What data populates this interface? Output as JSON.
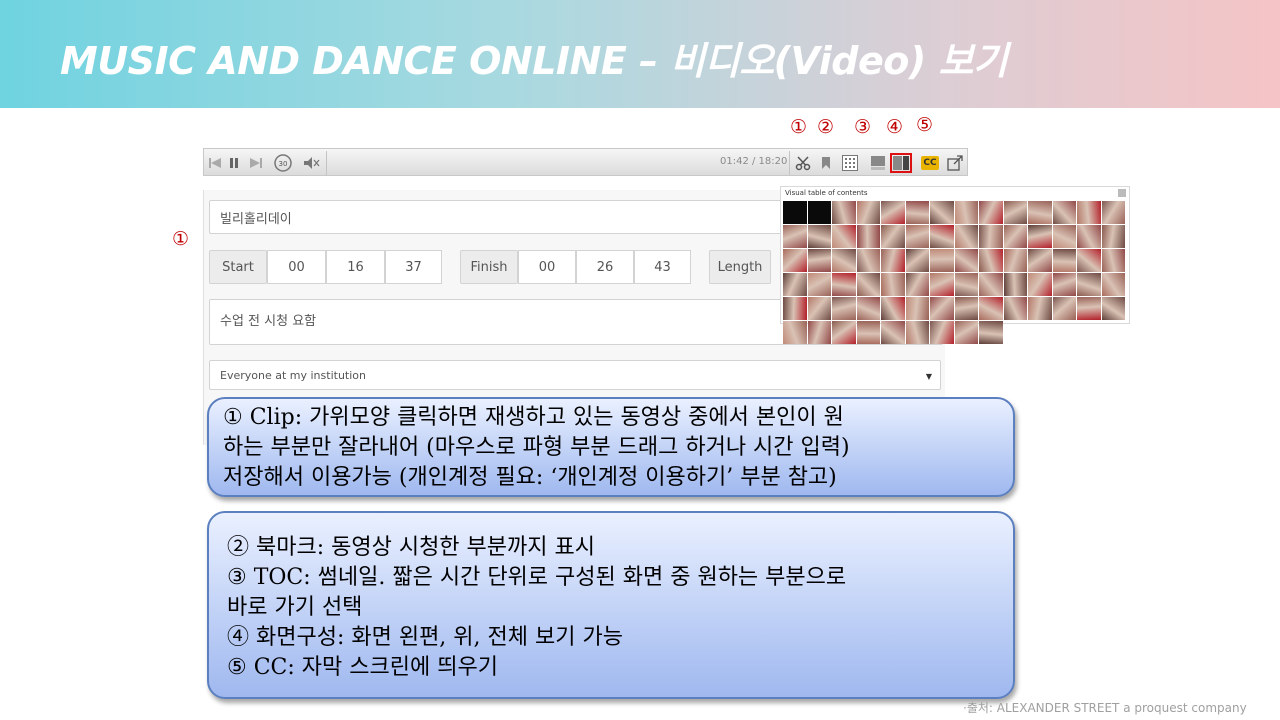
{
  "header": {
    "title": "MUSIC AND DANCE ONLINE – 비디오(Video) 보기"
  },
  "player": {
    "time": "01:42 / 18:20",
    "cc_label": "CC",
    "markers": [
      "①",
      "②",
      "③",
      "④",
      "⑤"
    ]
  },
  "form": {
    "marker": "①",
    "title_value": "빌리홀리데이",
    "start_label": "Start",
    "start": [
      "00",
      "16",
      "37"
    ],
    "finish_label": "Finish",
    "finish": [
      "00",
      "26",
      "43"
    ],
    "length_label": "Length",
    "note_value": "수업 전 시청 요함",
    "share_value": "Everyone at my institution"
  },
  "vtoc": {
    "title": "Visual table of contents",
    "thumb_count": 79
  },
  "callout1": {
    "lines": [
      "① Clip: 가위모양 클릭하면 재생하고 있는 동영상 중에서 본인이 원",
      "하는 부분만 잘라내어 (마우스로 파형 부분 드래그 하거나 시간 입력)",
      "저장해서 이용가능 (개인계정 필요: ‘개인계정 이용하기’ 부분 참고)"
    ]
  },
  "callout2": {
    "lines": [
      "② 북마크: 동영상 시청한 부분까지 표시",
      "③ TOC: 썸네일. 짧은 시간 단위로 구성된 화면 중 원하는 부분으로",
      "바로 가기 선택",
      "④ 화면구성: 화면 왼편, 위, 전체 보기 가능",
      "⑤ CC: 자막 스크린에 띄우기"
    ]
  },
  "source": "·출처: ALEXANDER STREET a proquest company",
  "colors": {
    "marker_red": "#c00000",
    "callout_border": "#5b7fbf",
    "cc_yellow": "#e9b400"
  }
}
